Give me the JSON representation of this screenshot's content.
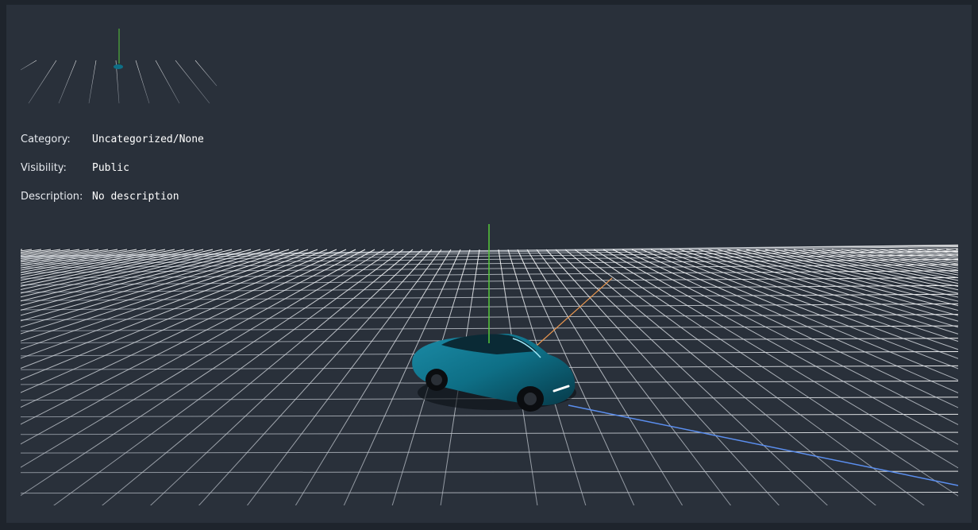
{
  "details": {
    "category": {
      "label": "Category:",
      "value": "Uncategorized/None"
    },
    "visibility": {
      "label": "Visibility:",
      "value": "Public"
    },
    "description": {
      "label": "Description:",
      "value": "No description"
    }
  },
  "scene": {
    "background": "#29303a",
    "grid_color": "#c9ced6",
    "axis_colors": {
      "x": "#5b8ff0",
      "y": "#56c93a",
      "z": "#e8964f"
    },
    "car_color": "#0e6f86",
    "model_icon": "car-model"
  }
}
